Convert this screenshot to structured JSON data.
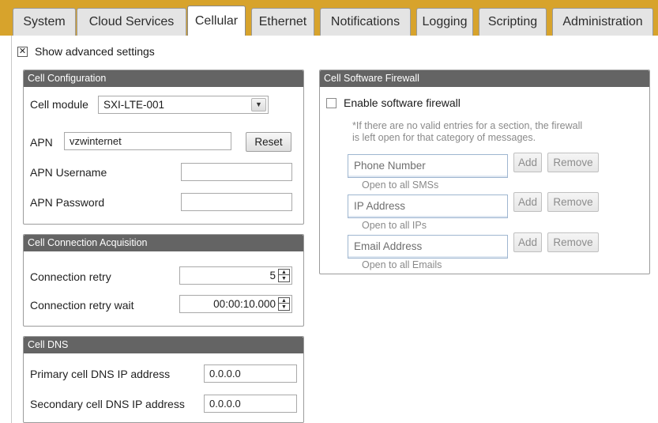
{
  "tabs": [
    {
      "label": "System"
    },
    {
      "label": "Cloud Services"
    },
    {
      "label": "Cellular"
    },
    {
      "label": "Ethernet"
    },
    {
      "label": "Notifications"
    },
    {
      "label": "Logging"
    },
    {
      "label": "Scripting"
    },
    {
      "label": "Administration"
    }
  ],
  "active_tab": "Cellular",
  "show_advanced": {
    "label": "Show advanced settings",
    "checked": true
  },
  "cell_config": {
    "title": "Cell Configuration",
    "module_label": "Cell module",
    "module_value": "SXI-LTE-001",
    "apn_label": "APN",
    "apn_value": "vzwinternet",
    "reset_label": "Reset",
    "apn_user_label": "APN Username",
    "apn_user_value": "",
    "apn_pass_label": "APN Password",
    "apn_pass_value": ""
  },
  "cell_acq": {
    "title": "Cell Connection Acquisition",
    "retry_label": "Connection retry",
    "retry_value": "5",
    "retry_wait_label": "Connection retry wait",
    "retry_wait_value": "00:00:10.000"
  },
  "cell_dns": {
    "title": "Cell DNS",
    "primary_label": "Primary cell DNS IP address",
    "primary_value": "0.0.0.0",
    "secondary_label": "Secondary cell DNS IP address",
    "secondary_value": "0.0.0.0"
  },
  "firewall": {
    "title": "Cell Software Firewall",
    "enable_label": "Enable software firewall",
    "enable_checked": false,
    "note_line1": "*If there are no valid entries for a section, the firewall",
    "note_line2": "is left open for that category of messages.",
    "add_label": "Add",
    "remove_label": "Remove",
    "sections": [
      {
        "placeholder": "Phone Number",
        "status": "Open to all SMSs"
      },
      {
        "placeholder": "IP Address",
        "status": "Open to all IPs"
      },
      {
        "placeholder": "Email Address",
        "status": "Open to all Emails"
      }
    ]
  },
  "colors": {
    "tabbar": "#d7a32c",
    "panel_header": "#646464"
  }
}
